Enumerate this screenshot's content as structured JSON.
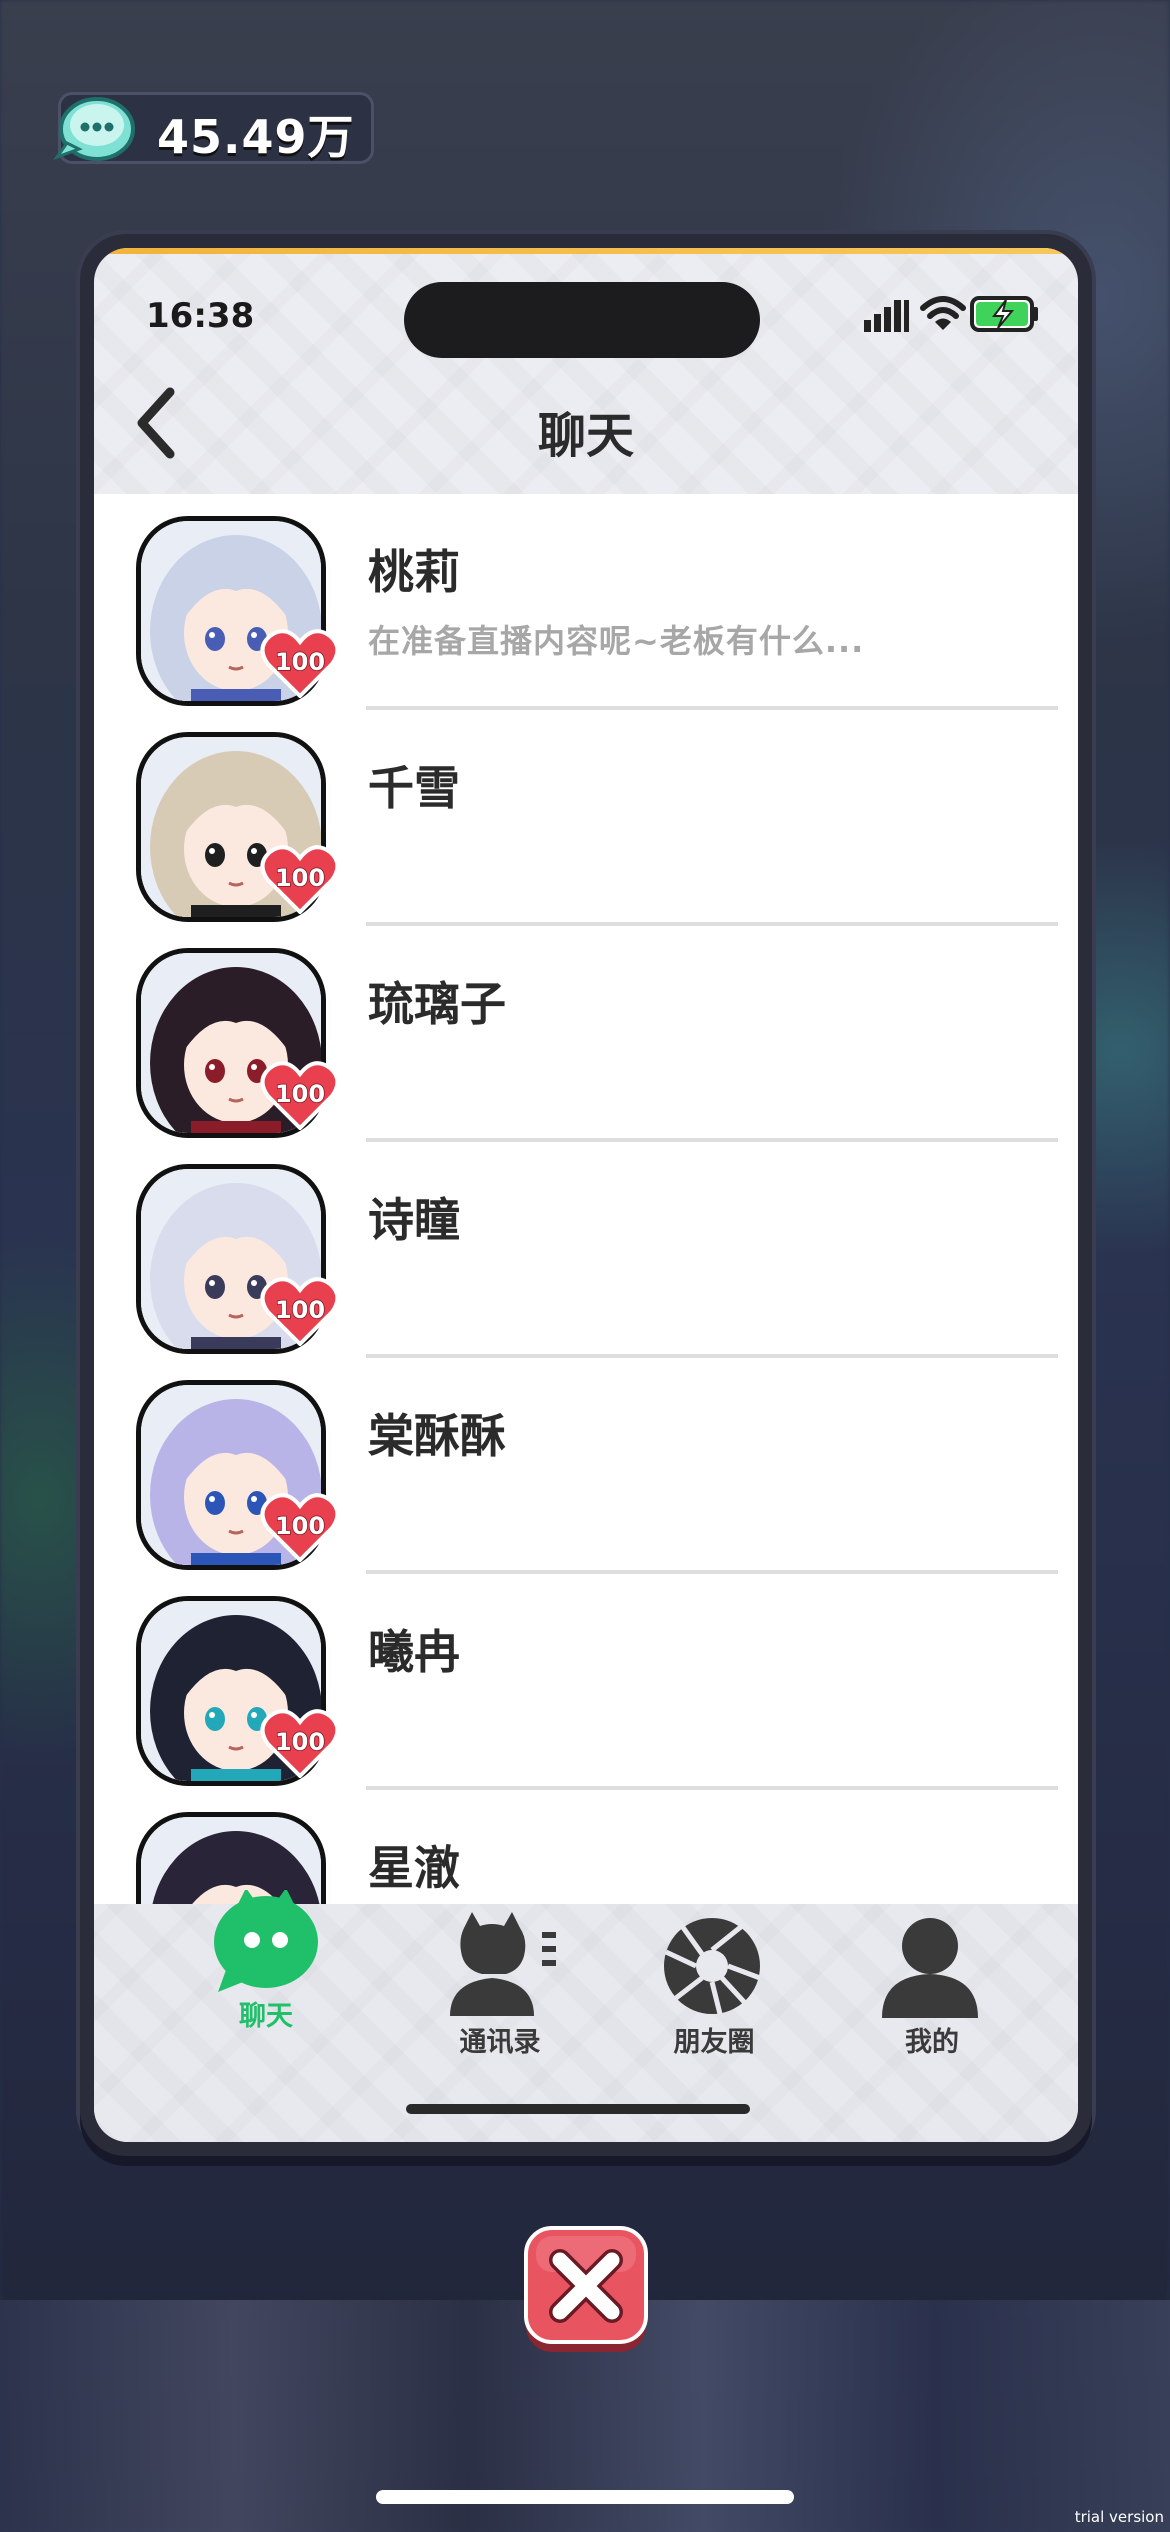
{
  "hud": {
    "currency_icon": "chat-bubble-coin-icon",
    "currency_value": "45.49万"
  },
  "status_bar": {
    "time": "16:38",
    "signal_icon": "signal-bars-icon",
    "wifi_icon": "wifi-icon",
    "battery_icon": "battery-charging-icon"
  },
  "header": {
    "back_icon": "chevron-left-icon",
    "title": "聊天"
  },
  "contacts": [
    {
      "name": "桃莉",
      "preview": "在准备直播内容呢~老板有什么...",
      "affection": "100",
      "hair": "#c9d2e6",
      "accent": "#4a5db5"
    },
    {
      "name": "千雪",
      "preview": "",
      "affection": "100",
      "hair": "#d8cbb6",
      "accent": "#1f1f1f"
    },
    {
      "name": "琉璃子",
      "preview": "",
      "affection": "100",
      "hair": "#2a1d28",
      "accent": "#8b1d2a"
    },
    {
      "name": "诗瞳",
      "preview": "",
      "affection": "100",
      "hair": "#d9dcec",
      "accent": "#3a3a5a"
    },
    {
      "name": "棠酥酥",
      "preview": "",
      "affection": "100",
      "hair": "#b9b4e8",
      "accent": "#2b56b8"
    },
    {
      "name": "曦冉",
      "preview": "",
      "affection": "100",
      "hair": "#1f2233",
      "accent": "#22a8b8"
    },
    {
      "name": "星澈",
      "preview": "",
      "affection": "",
      "hair": "#2a2438",
      "accent": "#d6c27a"
    }
  ],
  "tabs": [
    {
      "label": "聊天",
      "icon": "chat-bubble-icon",
      "active": true
    },
    {
      "label": "通讯录",
      "icon": "contacts-icon",
      "active": false
    },
    {
      "label": "朋友圈",
      "icon": "aperture-icon",
      "active": false
    },
    {
      "label": "我的",
      "icon": "user-icon",
      "active": false
    }
  ],
  "close_icon": "close-x-icon",
  "watermark": "trial version",
  "colors": {
    "active_tab": "#20c06a",
    "heart": "#e8404f",
    "close_button": "#e85561"
  }
}
